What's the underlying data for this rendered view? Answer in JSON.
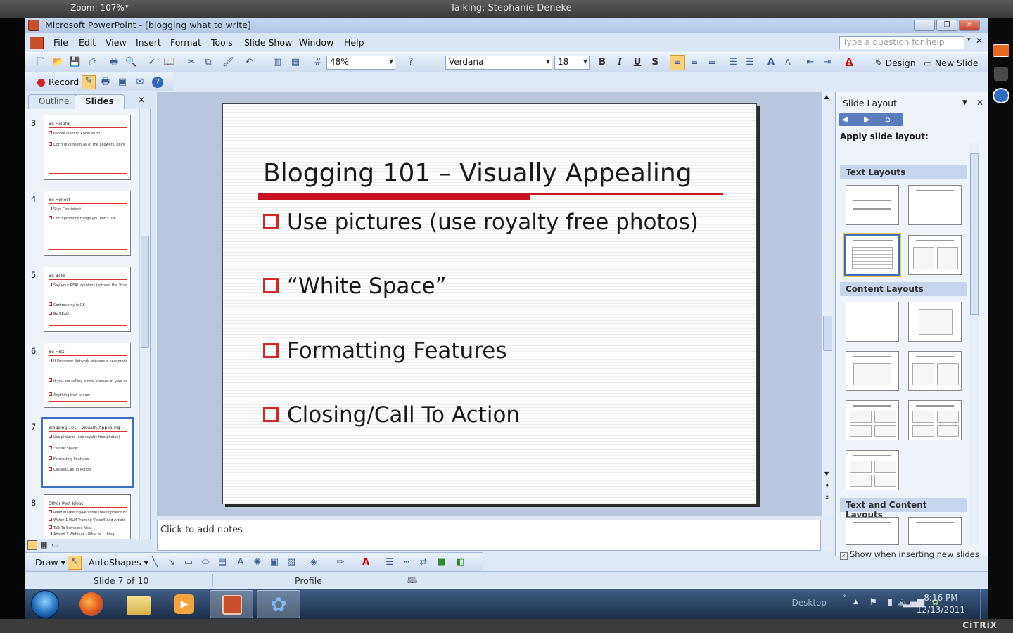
{
  "citrix": {
    "zoom": "Zoom: 107%",
    "talking": "Talking: Stephanie Deneke",
    "logo": "CiTRiX"
  },
  "window": {
    "title": "Microsoft PowerPoint - [blogging what to write]"
  },
  "menu": [
    "File",
    "Edit",
    "View",
    "Insert",
    "Format",
    "Tools",
    "Slide Show",
    "Window",
    "Help"
  ],
  "help_box": {
    "placeholder": "Type a question for help"
  },
  "toolbar": {
    "zoom_value": "48%",
    "font_name": "Verdana",
    "font_size": "18",
    "design_label": "Design",
    "new_slide_label": "New Slide",
    "bold": "B",
    "italic": "I",
    "underline": "U",
    "shadow": "S"
  },
  "record_bar": {
    "record_label": "Record"
  },
  "pane_tabs": {
    "outline": "Outline",
    "slides": "Slides"
  },
  "thumbnails": [
    {
      "num": "3",
      "title": "Be Helpful",
      "bullets": [
        "People want to know stuff!",
        "Don't give them all of the answers, point them to your resources"
      ]
    },
    {
      "num": "4",
      "title": "Be Honest",
      "bullets": [
        "Stay Consistent",
        "Don't promote things you don't use"
      ]
    },
    {
      "num": "5",
      "title": "Be Bold",
      "bullets": [
        "Say your REAL opinions (without the \"trash talk\" and NEVER use the word \"scam\")",
        "Controversy is OK",
        "Be REAL!"
      ]
    },
    {
      "num": "6",
      "title": "Be First",
      "bullets": [
        "If Empower Network releases a new product (hint hint) be the FIRST to write about it!",
        "If you are selling a new product of your own.",
        "Anything that is new."
      ]
    },
    {
      "num": "7",
      "title": "Blogging 101 – Visually Appealing",
      "bullets": [
        "Use pictures (use royalty free photos)",
        "\"White Space\"",
        "Formatting Features",
        "Closing/Call To Action"
      ]
    },
    {
      "num": "8",
      "title": "Other Post Ideas",
      "bullets": [
        "Read Marketing/Personal Development Books - Online/also",
        "Watch 1 MLM Training Video/Read Article and summarize",
        "Talk To Someone New",
        "Attend 1 Webinar - What is 1 thing"
      ]
    }
  ],
  "slide": {
    "title": "Blogging 101 – Visually Appealing",
    "bullets": [
      "Use pictures (use royalty free photos)",
      "“White Space”",
      "Formatting Features",
      "Closing/Call To Action"
    ]
  },
  "notes": {
    "placeholder": "Click to add notes"
  },
  "task_pane": {
    "title": "Slide Layout",
    "apply": "Apply slide layout:",
    "sections": [
      "Text Layouts",
      "Content Layouts",
      "Text and Content Layouts"
    ],
    "show_when": "Show when inserting new slides"
  },
  "draw_bar": {
    "draw": "Draw",
    "autoshapes": "AutoShapes"
  },
  "status": {
    "slide_info": "Slide 7 of 10",
    "design": "Profile"
  },
  "taskbar": {
    "desktop": "Desktop",
    "time": "8:16 PM",
    "date": "12/13/2011"
  },
  "colors": {
    "accent_red": "#c8141e",
    "selection_blue": "#3f6fc2"
  }
}
